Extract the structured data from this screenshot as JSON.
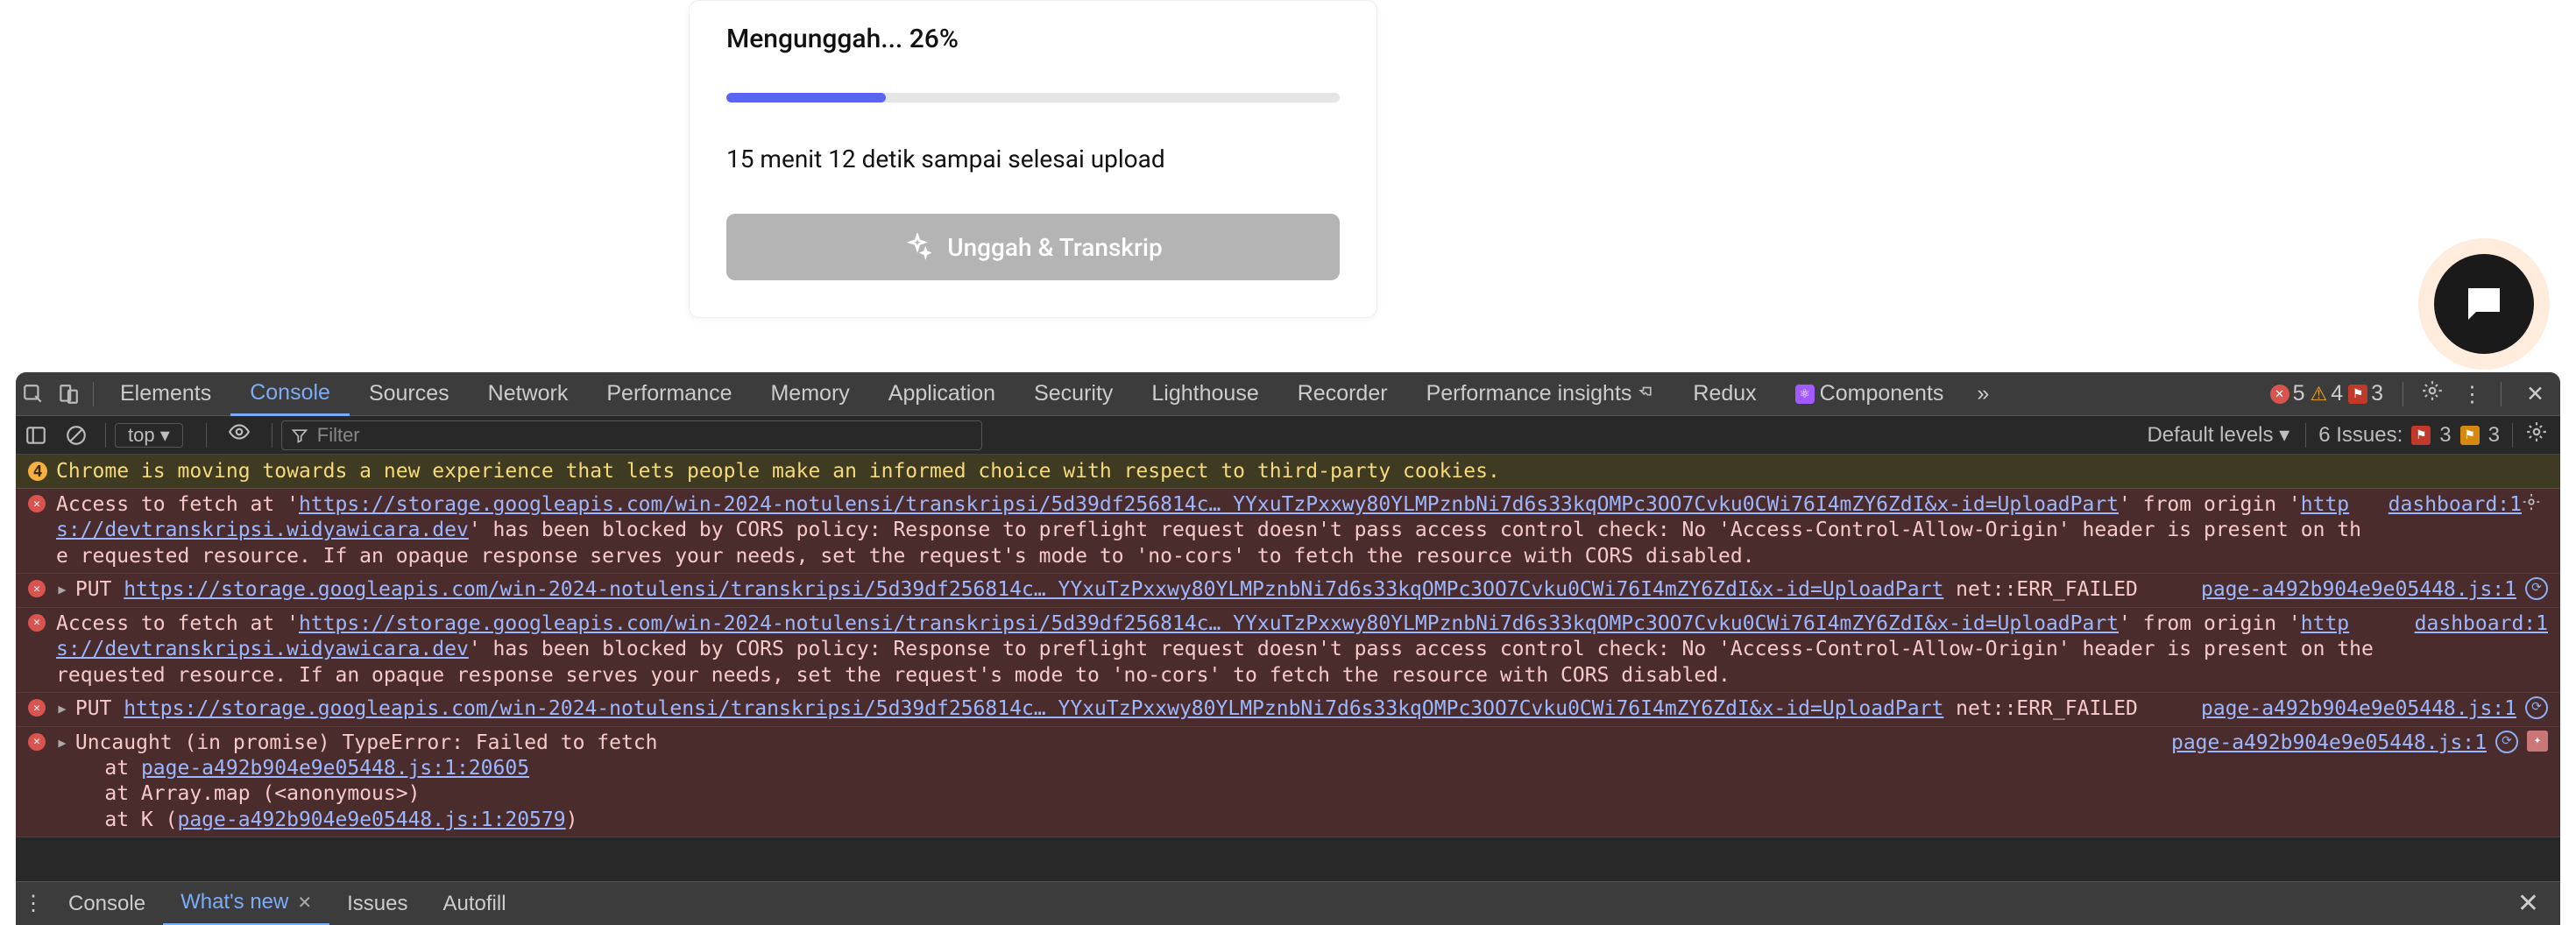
{
  "upload": {
    "status": "Mengunggah... 26%",
    "progress_pct": 26,
    "eta": "15 menit 12 detik sampai selesai upload",
    "button": "Unggah & Transkrip"
  },
  "devtools": {
    "tabs": [
      "Elements",
      "Console",
      "Sources",
      "Network",
      "Performance",
      "Memory",
      "Application",
      "Security",
      "Lighthouse",
      "Recorder",
      "Performance insights",
      "Redux",
      "Components"
    ],
    "active_tab": "Console",
    "more": "»",
    "counts": {
      "errors": "5",
      "warnings": "4",
      "flags": "3"
    }
  },
  "filter": {
    "context": "top ▾",
    "placeholder": "Filter",
    "levels": "Default levels ▾",
    "issues_label": "6 Issues:",
    "issues_red": "3",
    "issues_yellow": "3"
  },
  "cookie_banner": {
    "badge": "4",
    "text": "Chrome is moving towards a new experience that lets people make an informed choice with respect to third-party cookies."
  },
  "logs": [
    {
      "type": "err",
      "pre": "Access to fetch at '",
      "url": "https://storage.googleapis.com/win-2024-notulensi/transkripsi/5d39df256814c… YYxuTzPxxwy80YLMPznbNi7d6s33kqOMPc3OO7Cvku0CWi76I4mZY6ZdI&x-id=UploadPart",
      "mid": "' from origin '",
      "origin": "https://devtranskripsi.widyawicara.dev",
      "post": "' has been blocked by CORS policy: Response to preflight request doesn't pass access control check: No 'Access-Control-Allow-Origin' header is present on the requested resource. If an opaque response serves your needs, set the request's mode to 'no-cors' to fetch the resource with CORS disabled.",
      "src": "dashboard:1",
      "gear": true
    },
    {
      "type": "err",
      "arrow": true,
      "method": "PUT ",
      "url": "https://storage.googleapis.com/win-2024-notulensi/transkripsi/5d39df256814c… YYxuTzPxxwy80YLMPznbNi7d6s33kqOMPc3OO7Cvku0CWi76I4mZY6ZdI&x-id=UploadPart",
      "post": " net::ERR_FAILED",
      "src": "page-a492b904e9e05448.js:1",
      "vm": true
    },
    {
      "type": "err",
      "pre": "Access to fetch at '",
      "url": "https://storage.googleapis.com/win-2024-notulensi/transkripsi/5d39df256814c… YYxuTzPxxwy80YLMPznbNi7d6s33kqOMPc3OO7Cvku0CWi76I4mZY6ZdI&x-id=UploadPart",
      "mid": "' from origin '",
      "origin": "https://devtranskripsi.widyawicara.dev",
      "post": "' has been blocked by CORS policy: Response to preflight request doesn't pass access control check: No 'Access-Control-Allow-Origin' header is present on the requested resource. If an opaque response serves your needs, set the request's mode to 'no-cors' to fetch the resource with CORS disabled.",
      "src": "dashboard:1"
    },
    {
      "type": "err",
      "arrow": true,
      "method": "PUT ",
      "url": "https://storage.googleapis.com/win-2024-notulensi/transkripsi/5d39df256814c… YYxuTzPxxwy80YLMPznbNi7d6s33kqOMPc3OO7Cvku0CWi76I4mZY6ZdI&x-id=UploadPart",
      "post": " net::ERR_FAILED",
      "src": "page-a492b904e9e05448.js:1",
      "vm": true
    },
    {
      "type": "err",
      "arrow": true,
      "stack": [
        "Uncaught (in promise) TypeError: Failed to fetch",
        "    at page-a492b904e9e05448.js:1:20605",
        "    at Array.map (<anonymous>)",
        "    at K (page-a492b904e9e05448.js:1:20579)"
      ],
      "stack_links": [
        null,
        "page-a492b904e9e05448.js:1:20605",
        null,
        "page-a492b904e9e05448.js:1:20579"
      ],
      "src": "page-a492b904e9e05448.js:1",
      "vm": true,
      "ai": true
    }
  ],
  "drawer": {
    "tabs": [
      "Console",
      "What's new",
      "Issues",
      "Autofill"
    ],
    "active": "What's new"
  }
}
